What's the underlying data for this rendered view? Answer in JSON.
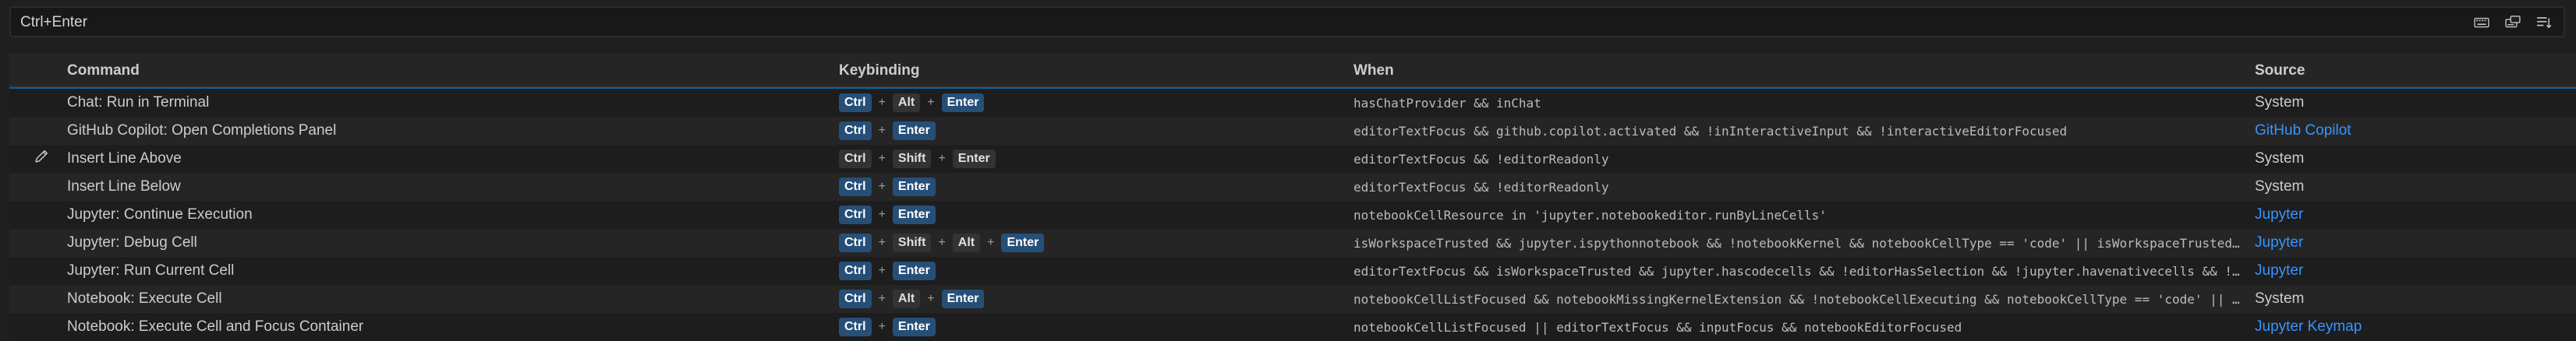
{
  "search": {
    "value": "Ctrl+Enter",
    "actions": [
      {
        "icon": "keyboard-icon"
      },
      {
        "icon": "record-keys-icon"
      },
      {
        "icon": "sort-by-precedence-icon"
      }
    ]
  },
  "table": {
    "headers": {
      "command": "Command",
      "keybinding": "Keybinding",
      "when": "When",
      "source": "Source"
    },
    "rows": [
      {
        "command": "Chat: Run in Terminal",
        "keys": [
          {
            "k": "Ctrl",
            "hl": true
          },
          {
            "k": "Alt",
            "hl": false
          },
          {
            "k": "Enter",
            "hl": true
          }
        ],
        "when": "hasChatProvider && inChat",
        "source": "System",
        "source_link": false,
        "editing": false
      },
      {
        "command": "GitHub Copilot: Open Completions Panel",
        "keys": [
          {
            "k": "Ctrl",
            "hl": true
          },
          {
            "k": "Enter",
            "hl": true
          }
        ],
        "when": "editorTextFocus && github.copilot.activated && !inInteractiveInput && !interactiveEditorFocused",
        "source": "GitHub Copilot",
        "source_link": true,
        "editing": false
      },
      {
        "command": "Insert Line Above",
        "keys": [
          {
            "k": "Ctrl",
            "hl": false
          },
          {
            "k": "Shift",
            "hl": false
          },
          {
            "k": "Enter",
            "hl": false
          }
        ],
        "when": "editorTextFocus && !editorReadonly",
        "source": "System",
        "source_link": false,
        "editing": true
      },
      {
        "command": "Insert Line Below",
        "keys": [
          {
            "k": "Ctrl",
            "hl": true
          },
          {
            "k": "Enter",
            "hl": true
          }
        ],
        "when": "editorTextFocus && !editorReadonly",
        "source": "System",
        "source_link": false,
        "editing": false
      },
      {
        "command": "Jupyter: Continue Execution",
        "keys": [
          {
            "k": "Ctrl",
            "hl": true
          },
          {
            "k": "Enter",
            "hl": true
          }
        ],
        "when": "notebookCellResource in 'jupyter.notebookeditor.runByLineCells'",
        "source": "Jupyter",
        "source_link": true,
        "editing": false
      },
      {
        "command": "Jupyter: Debug Cell",
        "keys": [
          {
            "k": "Ctrl",
            "hl": true
          },
          {
            "k": "Shift",
            "hl": false
          },
          {
            "k": "Alt",
            "hl": false
          },
          {
            "k": "Enter",
            "hl": true
          }
        ],
        "when": "isWorkspaceTrusted && jupyter.ispythonnotebook && !notebookKernel && notebookCellType == 'code' || isWorkspaceTrusted…",
        "source": "Jupyter",
        "source_link": true,
        "editing": false
      },
      {
        "command": "Jupyter: Run Current Cell",
        "keys": [
          {
            "k": "Ctrl",
            "hl": true
          },
          {
            "k": "Enter",
            "hl": true
          }
        ],
        "when": "editorTextFocus && isWorkspaceTrusted && jupyter.hascodecells && !editorHasSelection && !jupyter.havenativecells && !…",
        "source": "Jupyter",
        "source_link": true,
        "editing": false
      },
      {
        "command": "Notebook: Execute Cell",
        "keys": [
          {
            "k": "Ctrl",
            "hl": true
          },
          {
            "k": "Alt",
            "hl": false
          },
          {
            "k": "Enter",
            "hl": true
          }
        ],
        "when": "notebookCellListFocused && notebookMissingKernelExtension && !notebookCellExecuting && notebookCellType == 'code' || …",
        "source": "System",
        "source_link": false,
        "editing": false
      },
      {
        "command": "Notebook: Execute Cell and Focus Container",
        "keys": [
          {
            "k": "Ctrl",
            "hl": true
          },
          {
            "k": "Enter",
            "hl": true
          }
        ],
        "when": "notebookCellListFocused || editorTextFocus && inputFocus && notebookEditorFocused",
        "source": "Jupyter Keymap",
        "source_link": true,
        "editing": false
      }
    ]
  },
  "colors": {
    "accent": "#3794ff",
    "key_highlight": "#264f78",
    "background": "#1f1f1f"
  }
}
